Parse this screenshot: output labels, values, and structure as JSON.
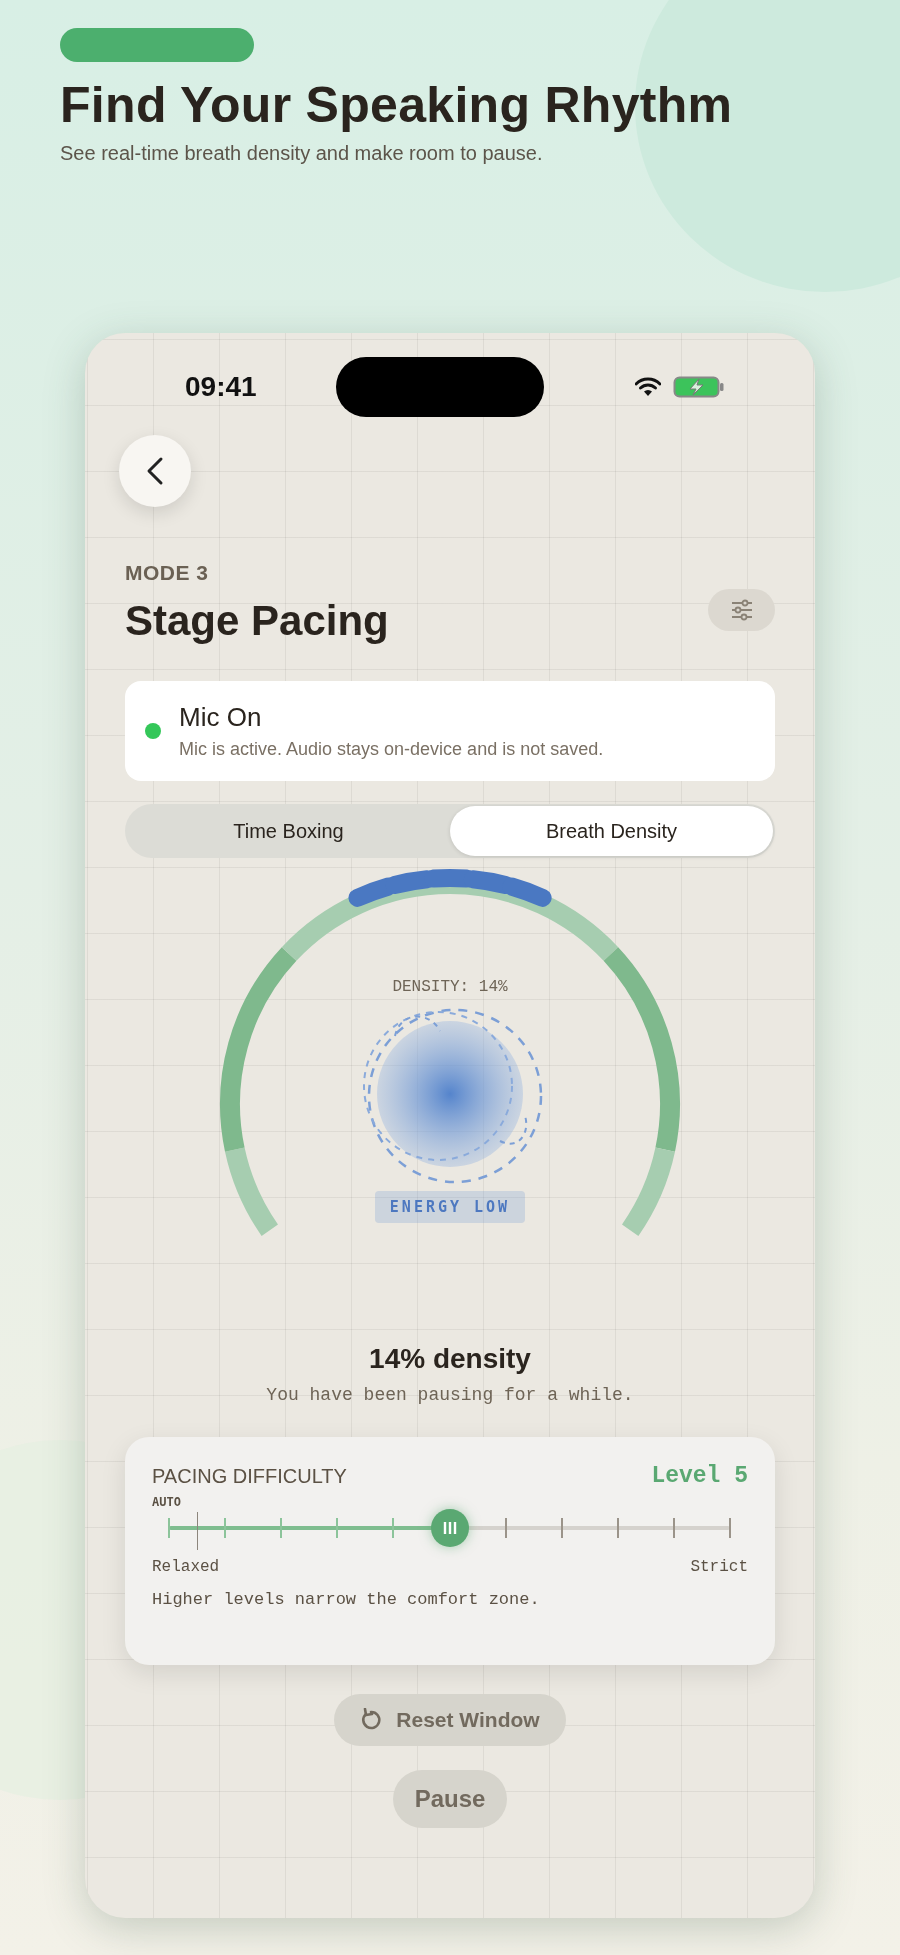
{
  "header": {
    "title": "Find Your Speaking Rhythm",
    "subtitle": "See real-time breath density and make room to pause."
  },
  "status_bar": {
    "time": "09:41"
  },
  "screen": {
    "eyebrow": "MODE 3",
    "title": "Stage Pacing"
  },
  "mic_status": {
    "title": "Mic On",
    "description": "Mic is active. Audio stays on-device and is not saved.",
    "on": true
  },
  "tabs": [
    {
      "label": "Time Boxing",
      "selected": false
    },
    {
      "label": "Breath Density",
      "selected": true
    }
  ],
  "gauge": {
    "reading": "DENSITY: 14%",
    "badge": "ENERGY LOW"
  },
  "summary": {
    "headline": "14% density",
    "message": "You have been pausing for a while."
  },
  "difficulty": {
    "title": "PACING DIFFICULTY",
    "value": "Level 5",
    "auto_label": "AUTO",
    "level": 0.5,
    "min_label": "Relaxed",
    "max_label": "Strict",
    "hint": "Higher levels narrow the comfort zone."
  },
  "buttons": [
    {
      "label": "Reset Window",
      "kind": "reset"
    },
    {
      "label": "Pause",
      "kind": "plain"
    }
  ]
}
